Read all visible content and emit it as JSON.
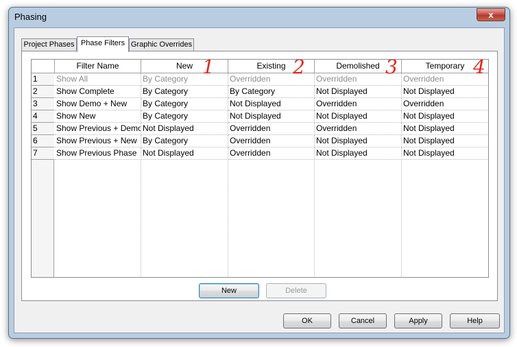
{
  "window": {
    "title": "Phasing",
    "close_glyph": "x"
  },
  "tabs": [
    {
      "label": "Project Phases",
      "active": false
    },
    {
      "label": "Phase Filters",
      "active": true
    },
    {
      "label": "Graphic Overrides",
      "active": false
    }
  ],
  "grid": {
    "columns": [
      "",
      "Filter Name",
      "New",
      "Existing",
      "Demolished",
      "Temporary"
    ],
    "rows": [
      {
        "num": "1",
        "name": "Show All",
        "new": "By Category",
        "existing": "Overridden",
        "demolished": "Overridden",
        "temporary": "Overridden",
        "disabled": true
      },
      {
        "num": "2",
        "name": "Show Complete",
        "new": "By Category",
        "existing": "By Category",
        "demolished": "Not Displayed",
        "temporary": "Not Displayed",
        "disabled": false
      },
      {
        "num": "3",
        "name": "Show Demo + New",
        "new": "By Category",
        "existing": "Not Displayed",
        "demolished": "Overridden",
        "temporary": "Overridden",
        "disabled": false
      },
      {
        "num": "4",
        "name": "Show New",
        "new": "By Category",
        "existing": "Not Displayed",
        "demolished": "Not Displayed",
        "temporary": "Not Displayed",
        "disabled": false
      },
      {
        "num": "5",
        "name": "Show Previous + Demo",
        "new": "Not Displayed",
        "existing": "Overridden",
        "demolished": "Overridden",
        "temporary": "Not Displayed",
        "disabled": false
      },
      {
        "num": "6",
        "name": "Show Previous + New",
        "new": "By Category",
        "existing": "Overridden",
        "demolished": "Not Displayed",
        "temporary": "Not Displayed",
        "disabled": false
      },
      {
        "num": "7",
        "name": "Show Previous Phase",
        "new": "Not Displayed",
        "existing": "Overridden",
        "demolished": "Not Displayed",
        "temporary": "Not Displayed",
        "disabled": false
      }
    ]
  },
  "annotations": [
    "1",
    "2",
    "3",
    "4"
  ],
  "panel_buttons": {
    "new": "New",
    "delete": "Delete"
  },
  "footer_buttons": {
    "ok": "OK",
    "cancel": "Cancel",
    "apply": "Apply",
    "help": "Help"
  },
  "colors": {
    "annotation": "#e0281e",
    "disabled_text": "#8d8d8d",
    "frame": "#b9cde2"
  }
}
